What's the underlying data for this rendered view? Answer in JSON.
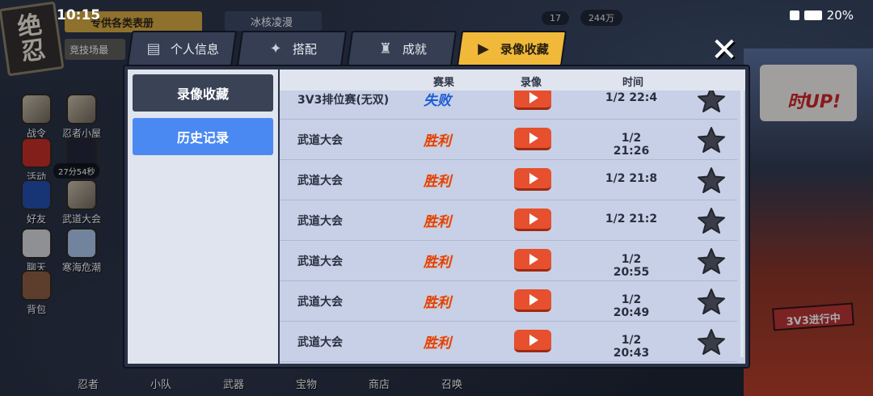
{
  "status_bar": {
    "time": "10:15",
    "battery": "20%"
  },
  "background": {
    "logo": "绝\n忍",
    "top_banner": "专供各类表册",
    "arena_banner": "竞技场最",
    "top_event": "冰核凌漫",
    "resources": [
      "17",
      "244万"
    ],
    "timer": "27分54秒",
    "right_promo": "时UP!",
    "right_badge": "3V3进行中",
    "left_icons": [
      {
        "label": "战令",
        "icon": "scroll-icon"
      },
      {
        "label": "忍者小屋",
        "icon": "house-icon"
      },
      {
        "label": "活动",
        "icon": "torii-icon"
      },
      {
        "label": "",
        "icon": "dragon-icon"
      },
      {
        "label": "好友",
        "icon": "ninja-icon"
      },
      {
        "label": "武道大会",
        "icon": "crossed-swords-icon"
      },
      {
        "label": "聊天",
        "icon": "chat-icon"
      },
      {
        "label": "寒海危潮",
        "icon": "wave-icon"
      },
      {
        "label": "背包",
        "icon": "bag-icon"
      }
    ],
    "bottom_nav": [
      "忍者",
      "小队",
      "武器",
      "宝物",
      "商店",
      "召唤"
    ]
  },
  "tabs": [
    {
      "label": "个人信息",
      "icon": "profile-card-icon",
      "active": false
    },
    {
      "label": "搭配",
      "icon": "shuriken-icon",
      "active": false
    },
    {
      "label": "成就",
      "icon": "trophy-icon",
      "active": false
    },
    {
      "label": "录像收藏",
      "icon": "play-icon",
      "active": true
    }
  ],
  "close_label": "✕",
  "sidebar": {
    "favorites": "录像收藏",
    "history": "历史记录"
  },
  "table": {
    "headers": {
      "result": "赛果",
      "replay": "录像",
      "time": "时间"
    },
    "rows": [
      {
        "mode": "3V3排位赛(无双)",
        "result": "失败",
        "outcome": "lose",
        "time": "1/2 22:4"
      },
      {
        "mode": "武道大会",
        "result": "胜利",
        "outcome": "win",
        "time": "1/2 21:26"
      },
      {
        "mode": "武道大会",
        "result": "胜利",
        "outcome": "win",
        "time": "1/2 21:8"
      },
      {
        "mode": "武道大会",
        "result": "胜利",
        "outcome": "win",
        "time": "1/2 21:2"
      },
      {
        "mode": "武道大会",
        "result": "胜利",
        "outcome": "win",
        "time": "1/2 20:55"
      },
      {
        "mode": "武道大会",
        "result": "胜利",
        "outcome": "win",
        "time": "1/2 20:49"
      },
      {
        "mode": "武道大会",
        "result": "胜利",
        "outcome": "win",
        "time": "1/2 20:43"
      }
    ]
  },
  "colors": {
    "active_tab": "#f0b93a",
    "history_button": "#4a89f2",
    "play_button": "#e6502e",
    "win": "#e0401c",
    "lose": "#1e5cd6"
  }
}
